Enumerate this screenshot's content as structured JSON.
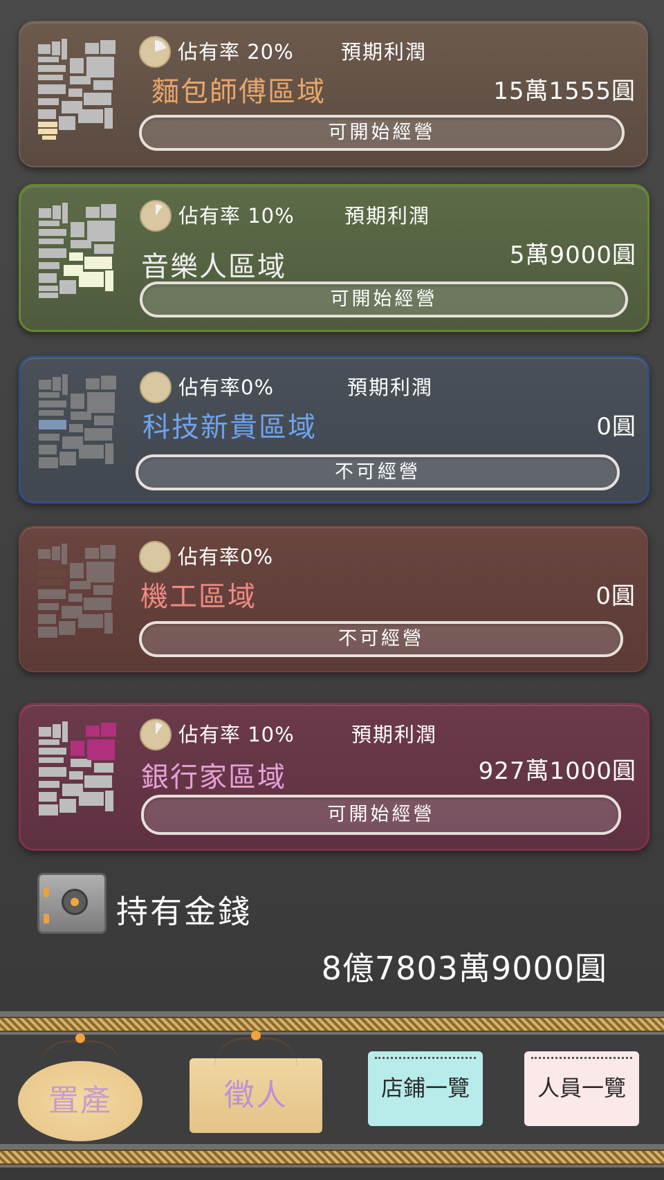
{
  "cards": [
    {
      "share": "佔有率 20%",
      "expected_label": "預期利潤",
      "name": "麵包師傅區域",
      "profit": "15萬1555圓",
      "action": "可開始經營",
      "name_color": "#e9a66b",
      "share_fraction": 0.2
    },
    {
      "share": "佔有率 10%",
      "expected_label": "預期利潤",
      "name": "音樂人區域",
      "profit": "5萬9000圓",
      "action": "可開始經營",
      "name_color": "#f0f0f0",
      "share_fraction": 0.1
    },
    {
      "share": "佔有率0%",
      "expected_label": "預期利潤",
      "name": "科技新貴區域",
      "profit": "0圓",
      "action": "不可經營",
      "name_color": "#6ea4ef",
      "share_fraction": 0.0
    },
    {
      "share": "佔有率0%",
      "name": "機工區域",
      "profit": "0圓",
      "action": "不可經營",
      "name_color": "#ee8b83",
      "share_fraction": 0.0
    },
    {
      "share": "佔有率 10%",
      "expected_label": "預期利潤",
      "name": "銀行家區域",
      "profit": "927萬1000圓",
      "action": "可開始經營",
      "name_color": "#e5a2d6",
      "share_fraction": 0.1
    }
  ],
  "money": {
    "label": "持有金錢",
    "value": "8億7803萬9000圓"
  },
  "nav": {
    "real_estate": "置產",
    "recruit": "徵人",
    "shop_list": "店鋪一覽",
    "staff_list": "人員一覽"
  },
  "colors": {
    "coin": "#d8c7a0",
    "rope": "#b89650"
  }
}
